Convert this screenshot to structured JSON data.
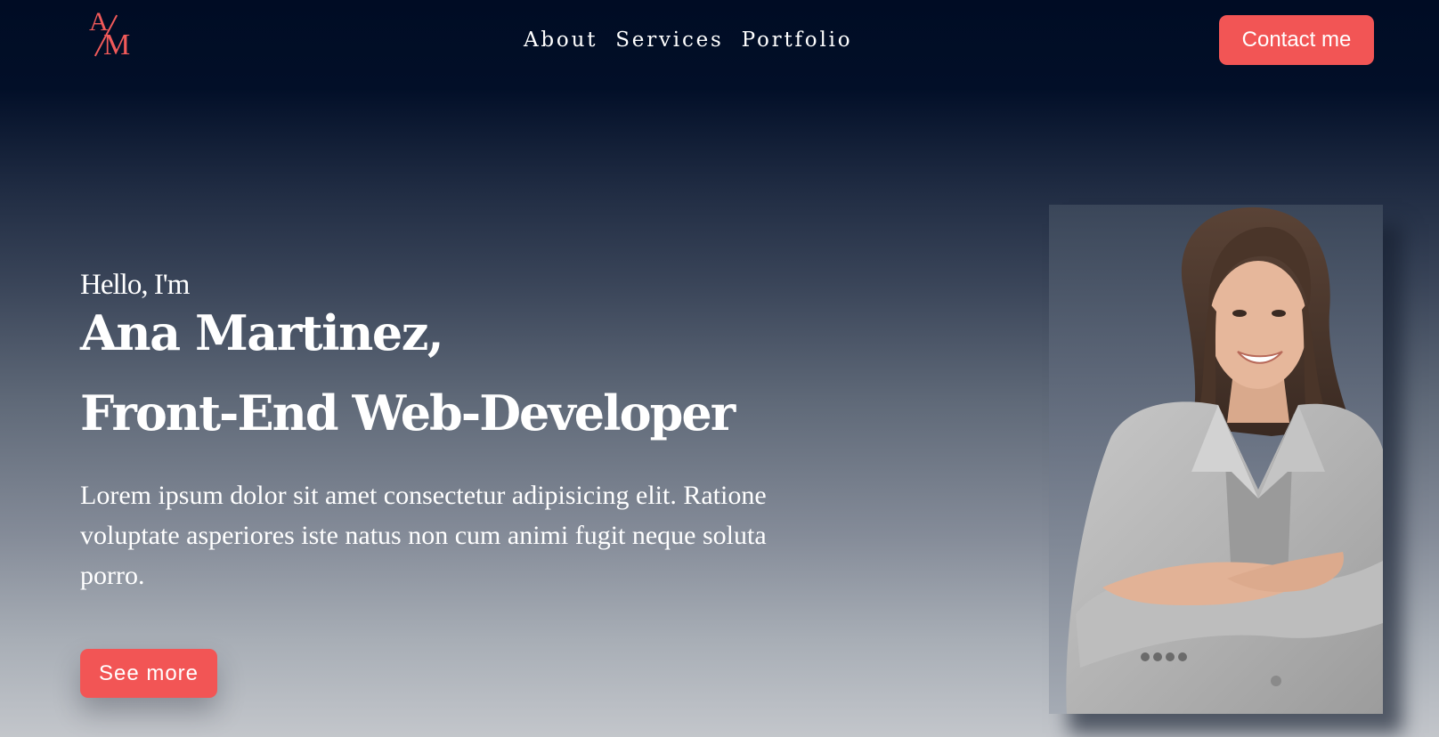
{
  "header": {
    "logo": {
      "letter_top": "A",
      "letter_bottom": "M",
      "color": "#f15a5a"
    },
    "nav": [
      "About",
      "Services",
      "Portfolio"
    ],
    "contact_label": "Contact me"
  },
  "hero": {
    "greeting": "Hello, I'm",
    "name": "Ana Martinez,",
    "role": "Front-End Web-Developer",
    "description": "Lorem ipsum dolor sit amet consectetur adipisicing elit. Ratione voluptate asperiores iste natus non cum animi fugit neque soluta porro.",
    "cta_label": "See more",
    "image_alt": "smiling woman with crossed arms in grey blazer"
  },
  "colors": {
    "accent": "#f25555",
    "background_top": "#000c24",
    "background_bottom": "#c3c6cb"
  }
}
